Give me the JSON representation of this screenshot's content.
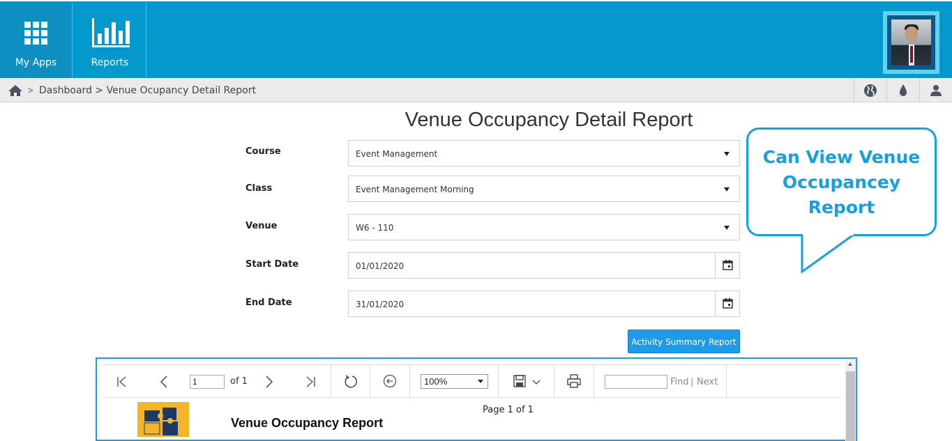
{
  "header": {
    "apps": [
      {
        "label": "My Apps",
        "icon": "grid-icon"
      },
      {
        "label": "Reports",
        "icon": "bar-chart-icon"
      }
    ],
    "colors": {
      "bar": "#0399cd",
      "avatar_border": "#5fd1f2"
    }
  },
  "breadcrumb": {
    "home_icon": "home-icon",
    "separator": ">",
    "trail": "Dashboard > Venue Ocupancy Detail Report",
    "right_icons": [
      "globe-icon",
      "drop-icon",
      "user-icon"
    ]
  },
  "page": {
    "title": "Venue Occupancy Detail Report"
  },
  "form": {
    "course": {
      "label": "Course",
      "value": "Event Management"
    },
    "class": {
      "label": "Class",
      "value": "Event Management Morning"
    },
    "venue": {
      "label": "Venue",
      "value": "W6 - 110"
    },
    "start_date": {
      "label": "Start Date",
      "value": "01/01/2020"
    },
    "end_date": {
      "label": "End Date",
      "value": "31/01/2020"
    },
    "submit_label": "Activity Summary Report"
  },
  "callout": {
    "line1": "Can View Venue",
    "line2": "Occupancey",
    "line3": "Report"
  },
  "viewer": {
    "page_value": "1",
    "of_label": "of 1",
    "zoom": "100%",
    "find_label": "Find",
    "divider": "|",
    "next_label": "Next",
    "report_title": "Venue Occupancy Report",
    "page_info": "Page 1 of 1"
  }
}
